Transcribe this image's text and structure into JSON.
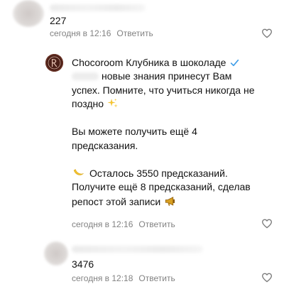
{
  "comments": [
    {
      "text": "227",
      "time": "сегодня в 12:16",
      "reply": "Ответить"
    },
    {
      "author": "Chocoroom Клубника в шоколаде",
      "verified_color": "#3f9de8",
      "line1": "новые знания принесут Вам",
      "line2": "успех. Помните, что учиться никогда не",
      "line3": "поздно",
      "line4": "Вы можете получить ещё 4",
      "line5": "предсказания.",
      "line6": "Осталось 3550 предсказаний.",
      "line7": "Получите ещё 8 предсказаний, сделав",
      "line8": "репост этой записи",
      "time": "сегодня в 12:16",
      "reply": "Ответить",
      "icons": [
        "sparkles-icon",
        "crescent-moon-icon",
        "megaphone-icon"
      ]
    },
    {
      "text": "3476",
      "time": "сегодня в 12:18",
      "reply": "Ответить"
    }
  ],
  "colors": {
    "meta": "#828282",
    "text": "#111111",
    "brand_avatar": "#4a1f17",
    "verified": "#3f9de8"
  }
}
